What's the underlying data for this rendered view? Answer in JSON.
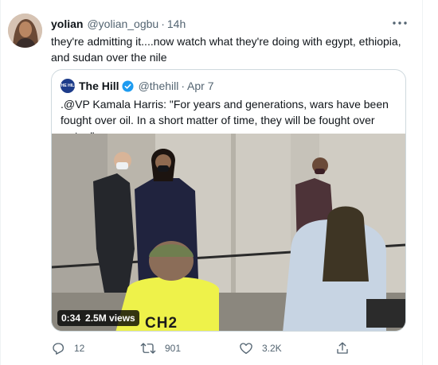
{
  "tweet": {
    "author_name": "yolian",
    "author_handle": "@yolian_ogbu",
    "separator": "·",
    "time": "14h",
    "text": "they're admitting it....now watch what they're doing with egypt, ethiopia, and sudan over the nile"
  },
  "quoted": {
    "avatar_text": "THE HILL",
    "author_name": "The Hill",
    "author_handle": "@thehill",
    "separator": "·",
    "date": "Apr 7",
    "text": ".@VP Kamala Harris: \"For years and generations, wars have been fought over oil. In a short matter of time, they will be fought over water.\""
  },
  "video": {
    "duration": "0:34",
    "views": "2.5M views",
    "shirt_text": "CH2"
  },
  "actions": {
    "reply_count": "12",
    "retweet_count": "901",
    "like_count": "3.2K"
  },
  "colors": {
    "text_primary": "#0f1419",
    "text_secondary": "#536471",
    "border": "#cfd9de",
    "verified": "#1d9bf0"
  },
  "icons": [
    "more-icon",
    "verified-icon",
    "reply-icon",
    "retweet-icon",
    "like-icon",
    "share-icon"
  ]
}
